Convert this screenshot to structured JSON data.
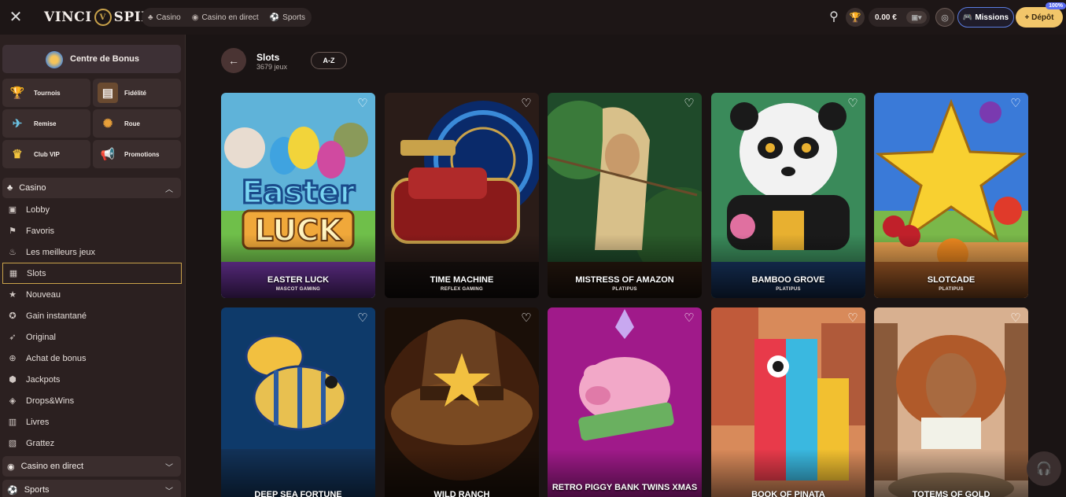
{
  "header": {
    "logo_left": "VINCI",
    "logo_right": "SPIN",
    "nav": [
      {
        "label": "Casino",
        "icon": "cherry-icon"
      },
      {
        "label": "Casino en direct",
        "icon": "live-icon"
      },
      {
        "label": "Sports",
        "icon": "ball-icon"
      }
    ],
    "balance": "0.00 €",
    "missions_label": "Missions",
    "depot_label": "Dépôt",
    "depot_badge": "100%"
  },
  "sidebar": {
    "bonus_center": "Centre de Bonus",
    "tiles": [
      {
        "label": "Tournois",
        "icon": "trophy-icon"
      },
      {
        "label": "Fidélité",
        "icon": "chest-icon"
      },
      {
        "label": "Remise",
        "icon": "cashback-icon"
      },
      {
        "label": "Roue",
        "icon": "wheel-icon"
      },
      {
        "label": "Club VIP",
        "icon": "crown-icon"
      },
      {
        "label": "Promotions",
        "icon": "megaphone-icon"
      }
    ],
    "casino_section": "Casino",
    "items": [
      {
        "label": "Lobby",
        "icon": "lobby-icon"
      },
      {
        "label": "Favoris",
        "icon": "flag-icon"
      },
      {
        "label": "Les meilleurs jeux",
        "icon": "fire-icon"
      },
      {
        "label": "Slots",
        "icon": "slot-icon"
      },
      {
        "label": "Nouveau",
        "icon": "star-icon"
      },
      {
        "label": "Gain instantané",
        "icon": "bolt-icon"
      },
      {
        "label": "Original",
        "icon": "rocket-icon"
      },
      {
        "label": "Achat de bonus",
        "icon": "cart-icon"
      },
      {
        "label": "Jackpots",
        "icon": "jackpot-icon"
      },
      {
        "label": "Drops&Wins",
        "icon": "drops-icon"
      },
      {
        "label": "Livres",
        "icon": "book-icon"
      },
      {
        "label": "Grattez",
        "icon": "scratch-icon"
      }
    ],
    "live_section": "Casino en direct",
    "sports_section": "Sports"
  },
  "main": {
    "title": "Slots",
    "subtitle": "3679 jeux",
    "sort_label": "A-Z",
    "games": [
      {
        "name": "EASTER LUCK",
        "provider": "MASCOT GAMING"
      },
      {
        "name": "TIME MACHINE",
        "provider": "REFLEX GAMING"
      },
      {
        "name": "MISTRESS OF AMAZON",
        "provider": "PLATIPUS"
      },
      {
        "name": "BAMBOO GROVE",
        "provider": "PLATIPUS"
      },
      {
        "name": "SLOTCADE",
        "provider": "PLATIPUS"
      },
      {
        "name": "DEEP SEA FORTUNE",
        "provider": ""
      },
      {
        "name": "WILD RANCH",
        "provider": ""
      },
      {
        "name": "RETRO PIGGY BANK TWINS XMAS",
        "provider": ""
      },
      {
        "name": "BOOK OF PINATA",
        "provider": ""
      },
      {
        "name": "TOTEMS OF GOLD",
        "provider": ""
      }
    ]
  },
  "colors": {
    "accent_gold": "#c9a24a",
    "missions_border": "#5b7ce0",
    "depot_bg": "#f2c66a"
  }
}
